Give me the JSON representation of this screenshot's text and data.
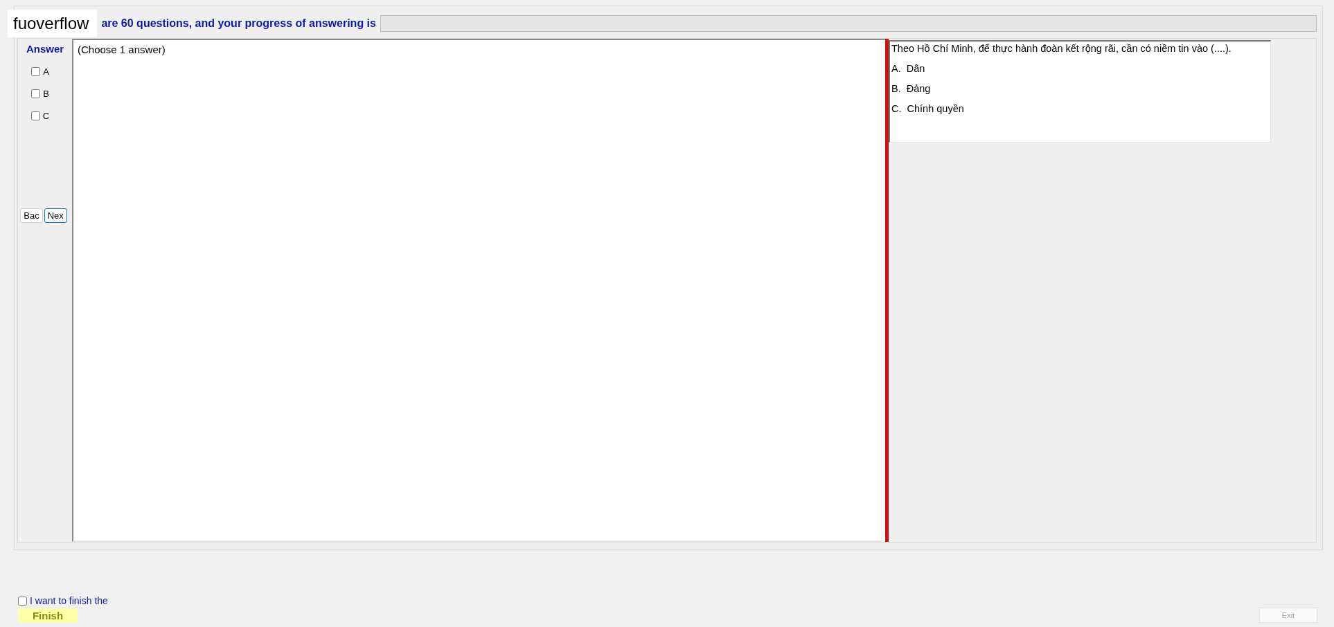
{
  "header": {
    "logo": "fuoverflow",
    "text": "are 60 questions, and your progress of answering is",
    "progress": {
      "level": 0
    }
  },
  "answer": {
    "title": "Answer",
    "options": [
      {
        "label": "A",
        "checked": false
      },
      {
        "label": "B",
        "checked": false
      },
      {
        "label": "C",
        "checked": false
      }
    ],
    "back": "Bac",
    "next": "Nex"
  },
  "answer_area": {
    "text": "(Choose 1 answer)"
  },
  "question": {
    "text": "Theo Hồ Chí Minh, để thực hành đoàn kết rộng rãi, cần có niềm tin vào (....).",
    "choices": [
      "A.  Dân",
      "B.  Đảng",
      "C.  Chính quyền"
    ]
  },
  "footer": {
    "confirm": {
      "label": "I want to finish the",
      "checked": false
    },
    "finish": "Finish",
    "exit": {
      "label": "Exit",
      "disabled": true
    }
  }
}
